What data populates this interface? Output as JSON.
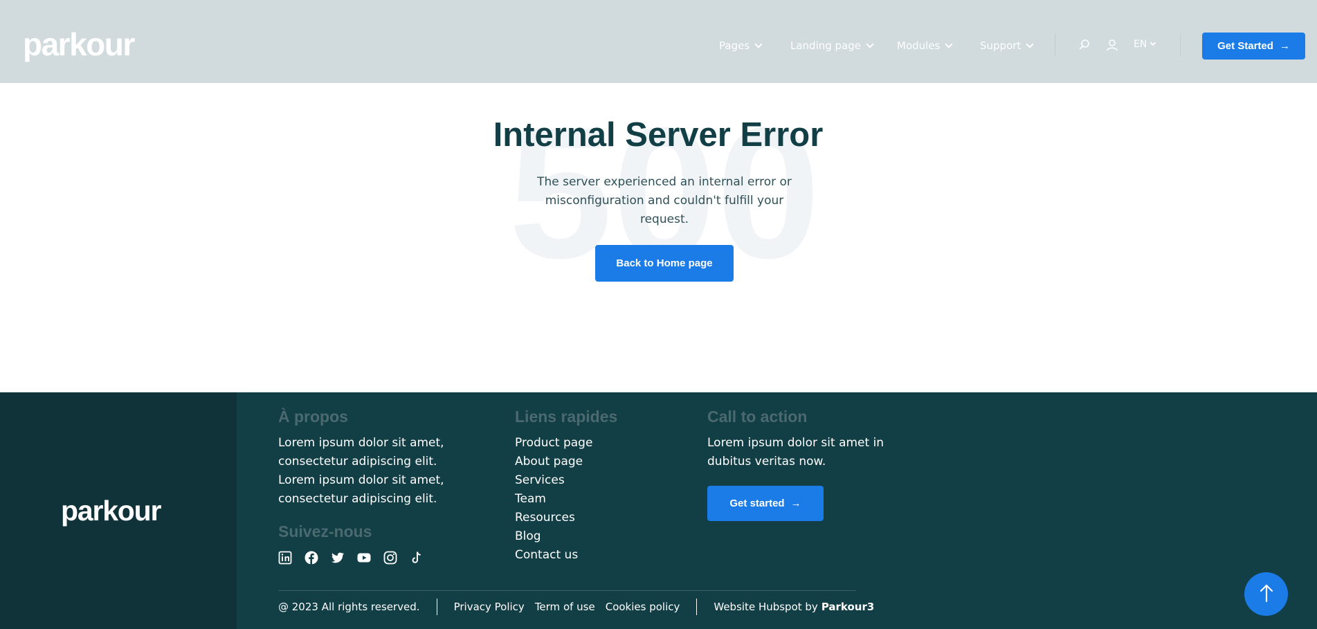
{
  "header": {
    "logo": "parkour",
    "nav": [
      {
        "label": "Pages"
      },
      {
        "label": "Landing page"
      },
      {
        "label": "Modules"
      },
      {
        "label": "Support"
      }
    ],
    "language": "EN",
    "cta_label": "Get Started",
    "icons": [
      "search-icon",
      "user-icon"
    ]
  },
  "hero": {
    "background_code": "500",
    "title": "Internal Server Error",
    "description": "The server experienced an internal error or misconfiguration and couldn't fulfill your request.",
    "button_label": "Back to Home page"
  },
  "footer": {
    "logo": "parkour",
    "about": {
      "title": "À propos",
      "text": "Lorem ipsum dolor sit amet, consectetur adipiscing elit. Lorem ipsum dolor sit amet, consectetur adipiscing elit."
    },
    "follow": {
      "title": "Suivez-nous",
      "socials": [
        "linkedin-icon",
        "facebook-icon",
        "twitter-icon",
        "youtube-icon",
        "instagram-icon",
        "tiktok-icon"
      ]
    },
    "quick_links": {
      "title": "Liens rapides",
      "items": [
        "Product page",
        "About page",
        "Services",
        "Team",
        "Resources",
        "Blog",
        "Contact us"
      ]
    },
    "cta": {
      "title": "Call to action",
      "text": "Lorem ipsum dolor sit amet in dubitus veritas now.",
      "button_label": "Get started"
    },
    "bottom": {
      "copyright": "@ 2023 All rights reserved.",
      "privacy": "Privacy Policy",
      "terms": "Term of use",
      "cookies": "Cookies policy",
      "credit_prefix": "Website Hubspot by",
      "credit_brand": "Parkour3"
    }
  },
  "colors": {
    "header_bg": "#d1dadc",
    "primary": "#1b7ce8",
    "footer_bg": "#123e45",
    "footer_left_bg": "#0f3338",
    "heading": "#123e45"
  }
}
